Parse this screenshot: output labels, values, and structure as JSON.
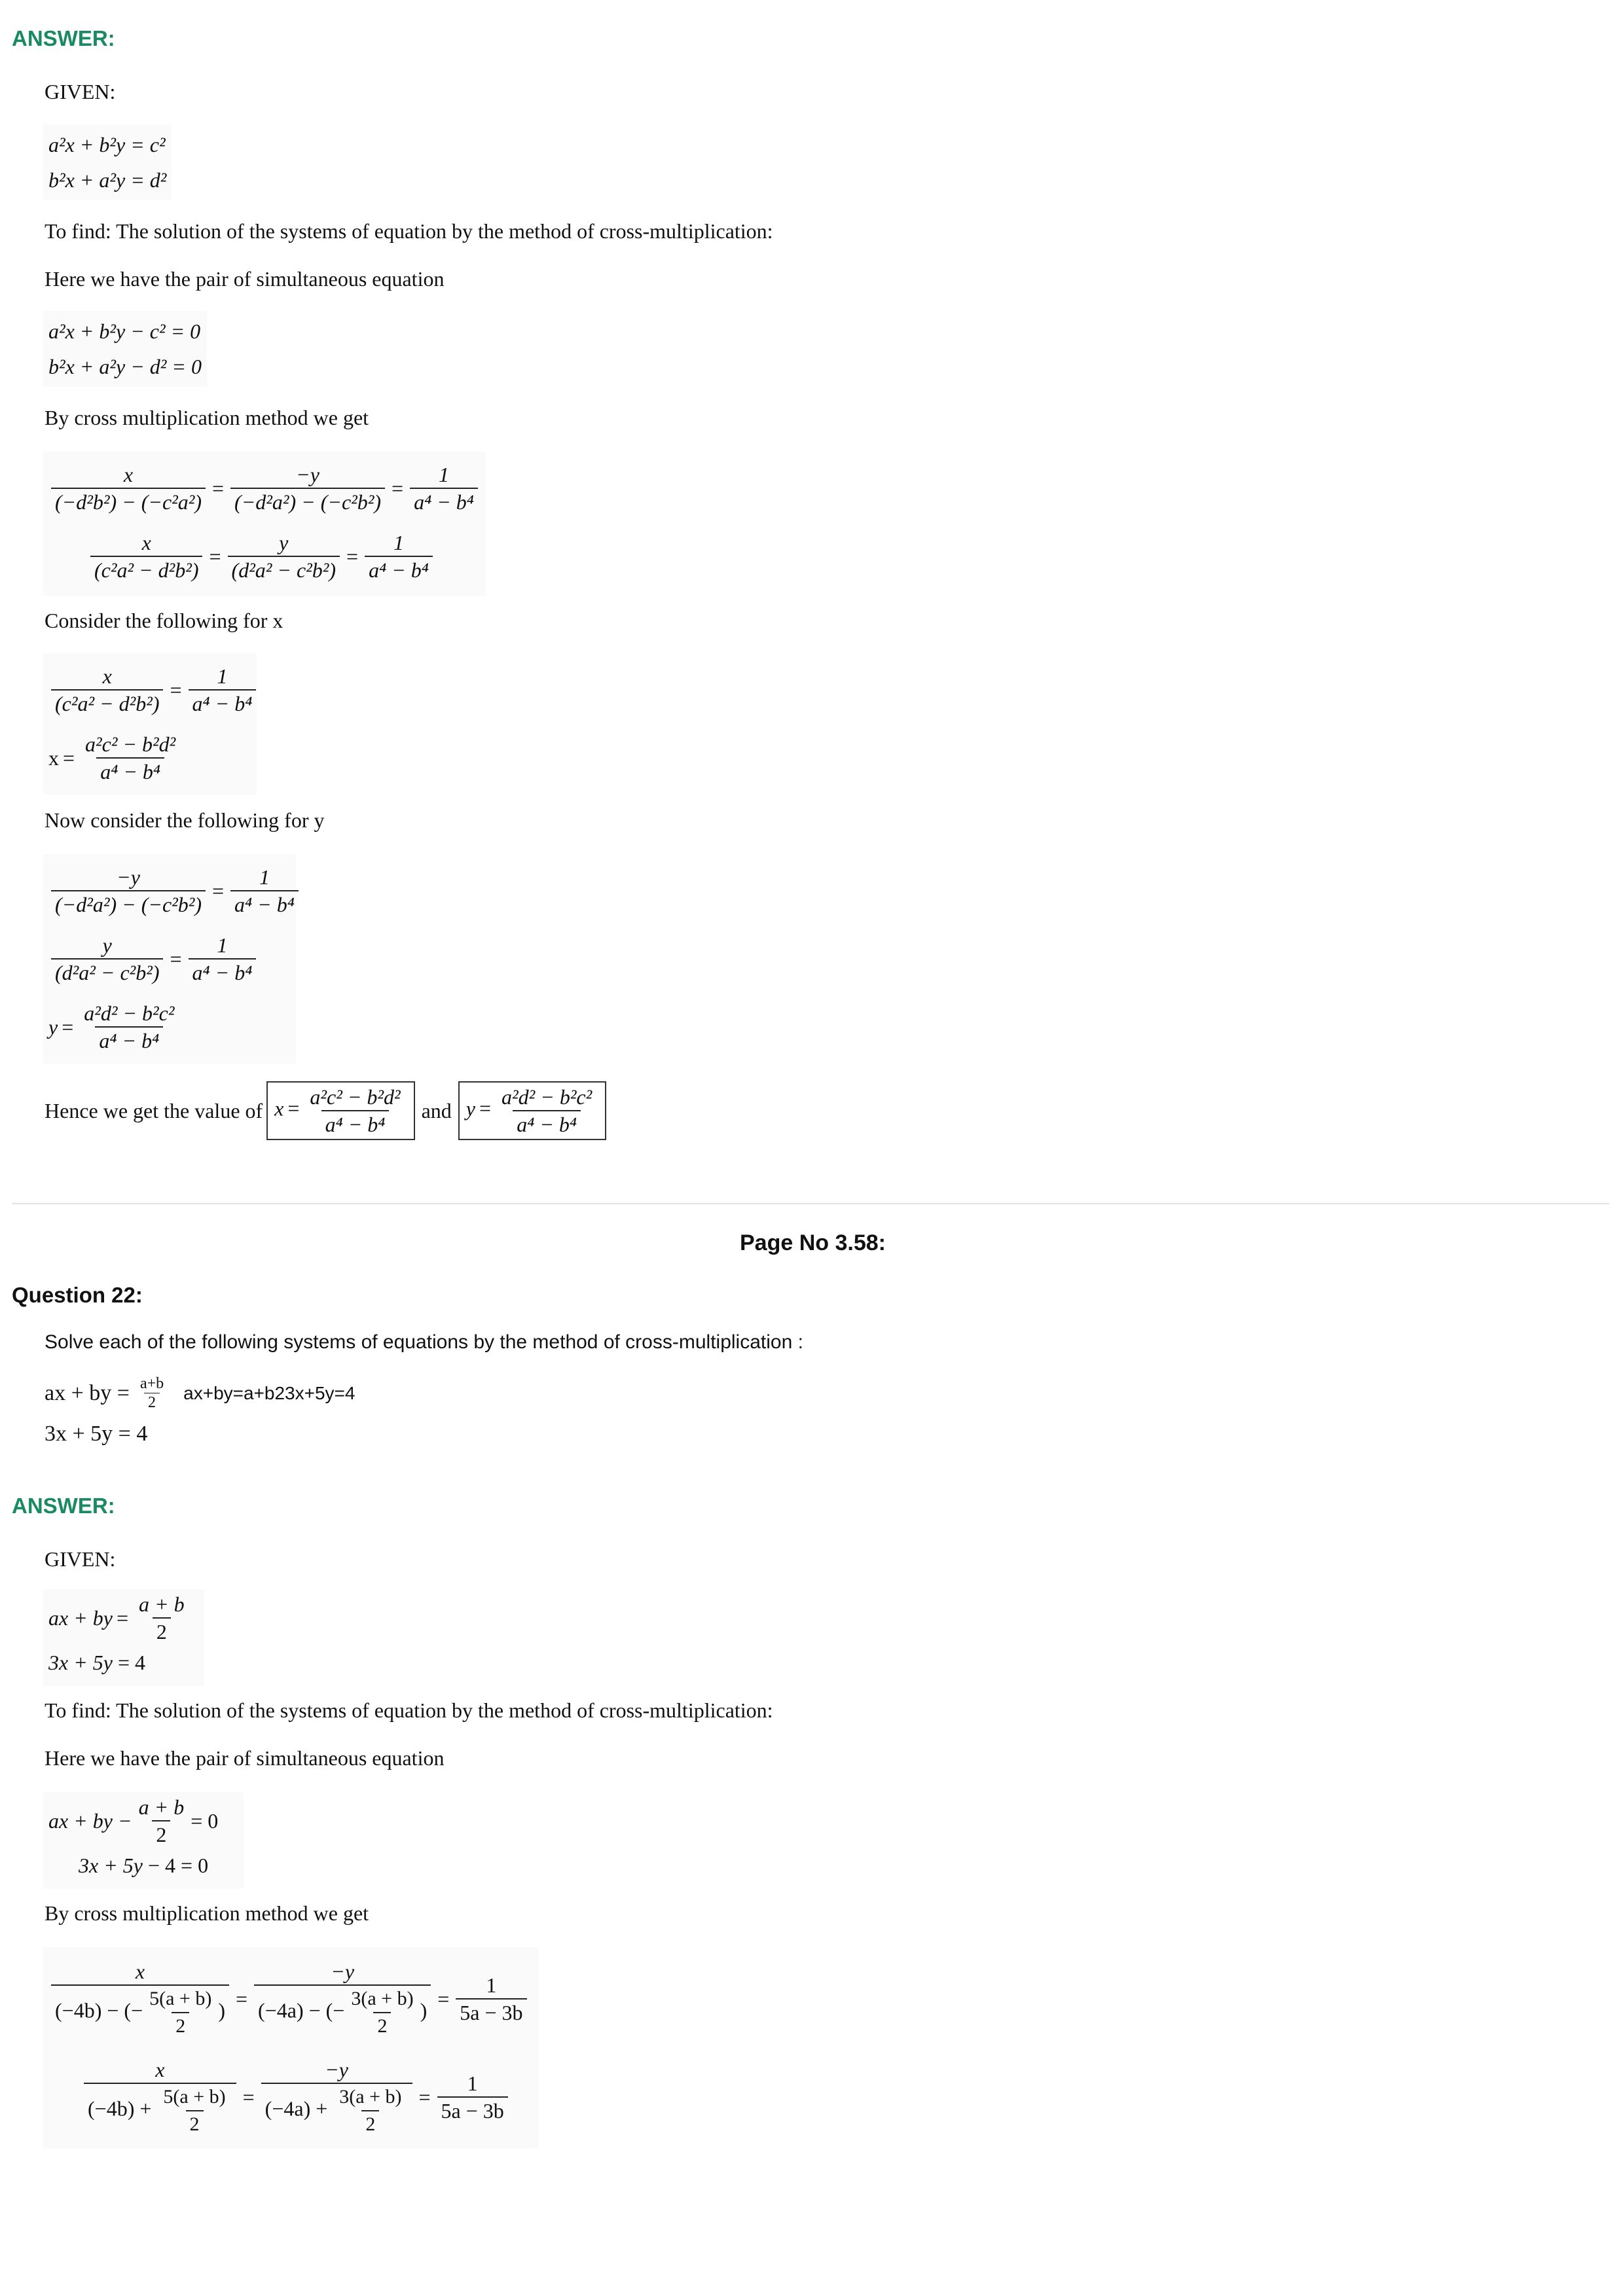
{
  "answer1": {
    "heading": "ANSWER:",
    "given": "GIVEN:",
    "eq1": "a²x + b²y = c²",
    "eq2": "b²x + a²y = d²",
    "to_find": "To find: The solution of the systems of equation by the method of cross-multiplication:",
    "here": "Here we have the pair of simultaneous equation",
    "sim1": "a²x + b²y − c² = 0",
    "sim2": "b²x + a²y − d² = 0",
    "cross": "By cross multiplication method we get",
    "consider_x": "Consider the following for x",
    "consider_y": "Now consider the following for y",
    "hence_prefix": "Hence we get the value of",
    "hence_and": "and"
  },
  "divider_label": "Page No 3.58:",
  "question22": {
    "title": "Question 22:",
    "text": "Solve each of the following systems of equations by the method of cross-multiplication :",
    "eq1_left": "ax + by =",
    "eq1_num": "a+b",
    "eq1_den": "2",
    "eq1_alt": "ax+by=a+b23x+5y=4",
    "eq2": "3x + 5y = 4"
  },
  "answer2": {
    "heading": "ANSWER:",
    "given": "GIVEN:",
    "to_find": "To find: The solution of the systems of equation by the method of cross-multiplication:",
    "here": "Here we have the pair of simultaneous equation",
    "cross": "By cross multiplication method we get"
  }
}
